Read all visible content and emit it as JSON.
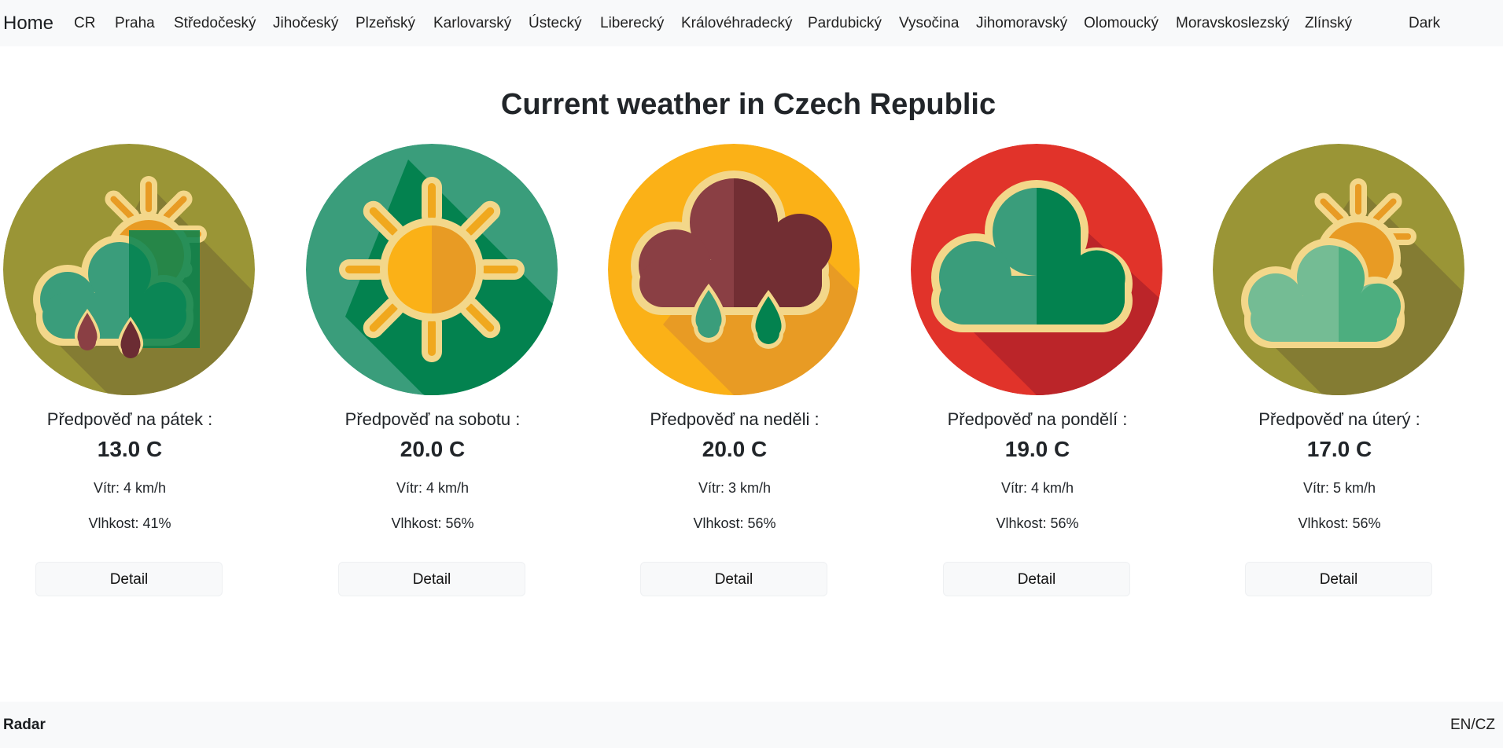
{
  "nav": {
    "brand": "Home",
    "items": [
      "CR",
      "Praha",
      "Středočeský",
      "Jihočeský",
      "Plzeňský",
      "Karlovarský",
      "Ústecký",
      "Liberecký",
      "Královéhradecký",
      "Pardubický",
      "Vysočina",
      "Jihomoravský",
      "Olomoucký",
      "Moravskoslezský",
      "Zlínský"
    ],
    "theme_toggle": "Dark"
  },
  "page": {
    "title": "Current weather in Czech Republic"
  },
  "forecasts": [
    {
      "label": "Předpověď na pátek :",
      "temp": "13.0 C",
      "wind": "Vítr: 4 km/h",
      "humidity": "Vlhkost: 41%",
      "button": "Detail",
      "icon": "sun-cloud-rain-icon",
      "bg_color": "#9a9536"
    },
    {
      "label": "Předpověď na sobotu :",
      "temp": "20.0 C",
      "wind": "Vítr: 4 km/h",
      "humidity": "Vlhkost: 56%",
      "button": "Detail",
      "icon": "sun-icon",
      "bg_color": "#3a9d7b"
    },
    {
      "label": "Předpověď na neděli :",
      "temp": "20.0 C",
      "wind": "Vítr: 3 km/h",
      "humidity": "Vlhkost: 56%",
      "button": "Detail",
      "icon": "rain-cloud-icon",
      "bg_color": "#fbb117"
    },
    {
      "label": "Předpověď na pondělí :",
      "temp": "19.0 C",
      "wind": "Vítr: 4 km/h",
      "humidity": "Vlhkost: 56%",
      "button": "Detail",
      "icon": "cloud-icon",
      "bg_color": "#e1332a"
    },
    {
      "label": "Předpověď na úterý :",
      "temp": "17.0 C",
      "wind": "Vítr: 5 km/h",
      "humidity": "Vlhkost: 56%",
      "button": "Detail",
      "icon": "partly-cloudy-icon",
      "bg_color": "#9a9536"
    }
  ],
  "footer": {
    "radar": "Radar",
    "lang": "EN/CZ"
  }
}
